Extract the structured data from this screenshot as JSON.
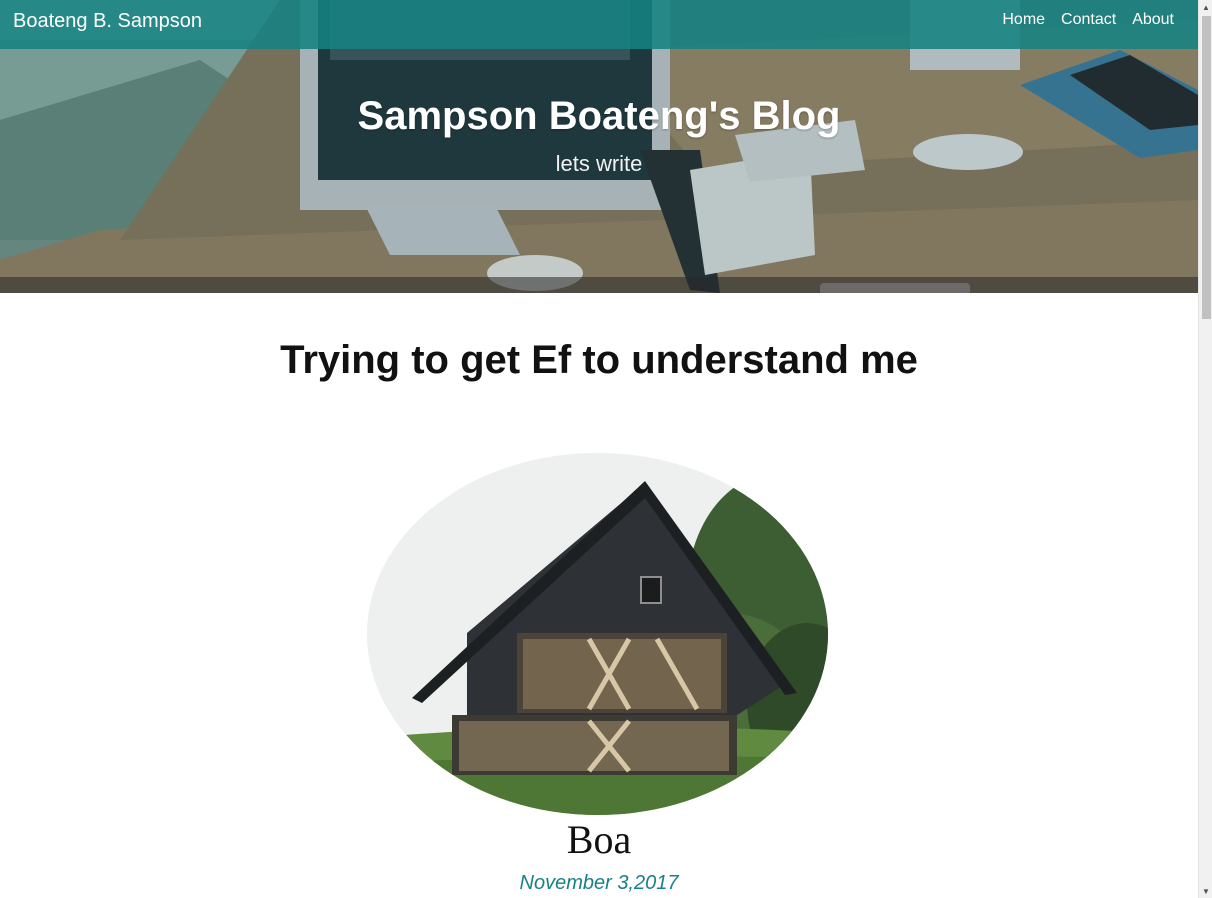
{
  "navbar": {
    "brand": "Boateng B. Sampson",
    "links": [
      "Home",
      "Contact",
      "About"
    ]
  },
  "hero": {
    "title": "Sampson Boateng's Blog",
    "subtitle": "lets write"
  },
  "post": {
    "title": "Trying to get Ef to understand me",
    "author": "Boa",
    "date": "November 3,2017"
  },
  "scrollbar": {
    "up_icon": "▲",
    "down_icon": "▼"
  },
  "colors": {
    "navbar": "#168282",
    "date_accent": "#1a7f86"
  }
}
